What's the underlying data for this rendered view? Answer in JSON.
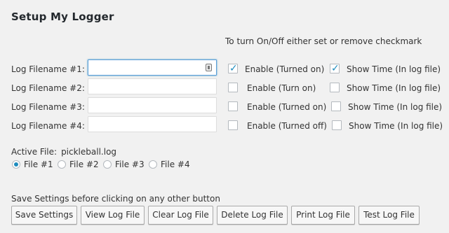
{
  "title": "Setup My Logger",
  "instruction": "To turn On/Off either set or remove checkmark",
  "rows": [
    {
      "label": "Log Filename #1:",
      "value": "",
      "enable_label": "Enable (Turned on)",
      "enable_checked": true,
      "show_time_label": "Show Time (In log file)",
      "show_time_checked": true
    },
    {
      "label": "Log Filename #2:",
      "value": "",
      "enable_label": "Enable (Turn on)",
      "enable_checked": false,
      "show_time_label": "Show Time (In log file)",
      "show_time_checked": false
    },
    {
      "label": "Log Filename #3:",
      "value": "",
      "enable_label": "Enable (Turned on)",
      "enable_checked": false,
      "show_time_label": "Show Time (In log file)",
      "show_time_checked": false
    },
    {
      "label": "Log Filename #4:",
      "value": "",
      "enable_label": "Enable (Turned off)",
      "enable_checked": false,
      "show_time_label": "Show Time (In log file)",
      "show_time_checked": false
    }
  ],
  "active_file": {
    "label": "Active File:",
    "value": "pickleball.log"
  },
  "radios": [
    {
      "label": "File #1",
      "checked": true
    },
    {
      "label": "File #2",
      "checked": false
    },
    {
      "label": "File #3",
      "checked": false
    },
    {
      "label": "File #4",
      "checked": false
    }
  ],
  "save_note": "Save Settings before clicking on any other button",
  "buttons": {
    "save": "Save Settings",
    "view": "View Log File",
    "clear": "Clear Log File",
    "delete": "Delete Log File",
    "print": "Print Log File",
    "test": "Test Log File"
  },
  "colors": {
    "background": "#f1f1f1",
    "accent": "#1e8cbe",
    "focus_border": "#5b9dd9"
  }
}
